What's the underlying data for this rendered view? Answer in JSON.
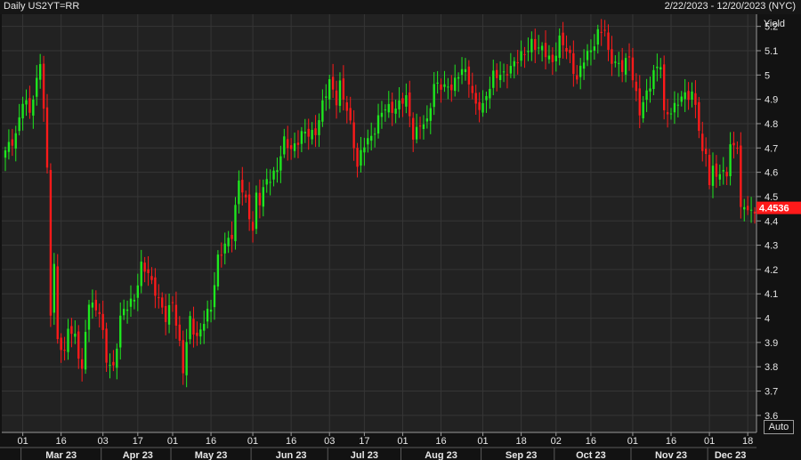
{
  "header": {
    "title": "Daily US2YT=RR",
    "date_range": "2/22/2023 - 12/20/2023 (NYC)"
  },
  "colors": {
    "up": "#1ee81e",
    "down": "#ff1a1a",
    "background": "#121212",
    "plot_background": "#222222",
    "grid": "#363636",
    "text": "#e6e6e6"
  },
  "auto_button": {
    "label": "Auto"
  },
  "chart_data": {
    "type": "candlestick",
    "ylabel": "Yield",
    "ylim": [
      3.53,
      5.25
    ],
    "y_ticks": [
      "3.6",
      "3.7",
      "3.8",
      "3.9",
      "4",
      "4.1",
      "4.2",
      "4.3",
      "4.4",
      "4.5",
      "4.6",
      "4.7",
      "4.8",
      "4.9",
      "5",
      "5.1",
      "5.2"
    ],
    "last_value": "4.4536",
    "x_day_ticks": [
      {
        "date": "2023-03-01",
        "label": "01"
      },
      {
        "date": "2023-03-16",
        "label": "16"
      },
      {
        "date": "2023-04-03",
        "label": "03"
      },
      {
        "date": "2023-04-17",
        "label": "17"
      },
      {
        "date": "2023-05-01",
        "label": "01"
      },
      {
        "date": "2023-05-16",
        "label": "16"
      },
      {
        "date": "2023-06-01",
        "label": "01"
      },
      {
        "date": "2023-06-16",
        "label": "16"
      },
      {
        "date": "2023-07-03",
        "label": "03"
      },
      {
        "date": "2023-07-17",
        "label": "17"
      },
      {
        "date": "2023-08-01",
        "label": "01"
      },
      {
        "date": "2023-08-16",
        "label": "16"
      },
      {
        "date": "2023-09-01",
        "label": "01"
      },
      {
        "date": "2023-09-18",
        "label": "18"
      },
      {
        "date": "2023-10-02",
        "label": "02"
      },
      {
        "date": "2023-10-16",
        "label": "16"
      },
      {
        "date": "2023-11-01",
        "label": "01"
      },
      {
        "date": "2023-11-16",
        "label": "16"
      },
      {
        "date": "2023-12-01",
        "label": "01"
      },
      {
        "date": "2023-12-18",
        "label": "18"
      }
    ],
    "x_month_labels": [
      {
        "date": "2023-03-16",
        "label": "Mar 23"
      },
      {
        "date": "2023-04-16",
        "label": "Apr 23"
      },
      {
        "date": "2023-05-16",
        "label": "May 23"
      },
      {
        "date": "2023-06-16",
        "label": "Jun 23"
      },
      {
        "date": "2023-07-16",
        "label": "Jul 23"
      },
      {
        "date": "2023-08-16",
        "label": "Aug 23"
      },
      {
        "date": "2023-09-16",
        "label": "Sep 23"
      },
      {
        "date": "2023-10-16",
        "label": "Oct 23"
      },
      {
        "date": "2023-11-16",
        "label": "Nov 23"
      },
      {
        "date": "2023-12-09",
        "label": "Dec 23"
      }
    ],
    "x_month_separators": [
      "2023-03-01",
      "2023-04-01",
      "2023-05-01",
      "2023-06-01",
      "2023-07-01",
      "2023-08-01",
      "2023-09-01",
      "2023-10-01",
      "2023-11-01",
      "2023-12-01"
    ],
    "x_range": [
      "2023-02-22",
      "2023-12-20"
    ],
    "close_anchors": [
      [
        "2023-02-22",
        4.68
      ],
      [
        "2023-02-27",
        4.76
      ],
      [
        "2023-03-01",
        4.89
      ],
      [
        "2023-03-03",
        4.85
      ],
      [
        "2023-03-07",
        4.98
      ],
      [
        "2023-03-08",
        5.06
      ],
      [
        "2023-03-09",
        4.85
      ],
      [
        "2023-03-10",
        4.6
      ],
      [
        "2023-03-13",
        4.03
      ],
      [
        "2023-03-14",
        4.22
      ],
      [
        "2023-03-15",
        3.92
      ],
      [
        "2023-03-17",
        3.84
      ],
      [
        "2023-03-20",
        3.96
      ],
      [
        "2023-03-22",
        3.93
      ],
      [
        "2023-03-24",
        3.78
      ],
      [
        "2023-03-28",
        4.07
      ],
      [
        "2023-03-31",
        4.03
      ],
      [
        "2023-04-04",
        3.82
      ],
      [
        "2023-04-06",
        3.8
      ],
      [
        "2023-04-10",
        4.0
      ],
      [
        "2023-04-14",
        4.09
      ],
      [
        "2023-04-18",
        4.21
      ],
      [
        "2023-04-20",
        4.18
      ],
      [
        "2023-04-24",
        4.12
      ],
      [
        "2023-04-27",
        3.99
      ],
      [
        "2023-05-01",
        4.08
      ],
      [
        "2023-05-03",
        3.89
      ],
      [
        "2023-05-04",
        3.78
      ],
      [
        "2023-05-08",
        4.0
      ],
      [
        "2023-05-10",
        3.92
      ],
      [
        "2023-05-12",
        3.98
      ],
      [
        "2023-05-16",
        4.05
      ],
      [
        "2023-05-18",
        4.25
      ],
      [
        "2023-05-22",
        4.29
      ],
      [
        "2023-05-24",
        4.35
      ],
      [
        "2023-05-26",
        4.57
      ],
      [
        "2023-05-30",
        4.47
      ],
      [
        "2023-06-01",
        4.37
      ],
      [
        "2023-06-02",
        4.51
      ],
      [
        "2023-06-05",
        4.48
      ],
      [
        "2023-06-07",
        4.56
      ],
      [
        "2023-06-12",
        4.62
      ],
      [
        "2023-06-14",
        4.72
      ],
      [
        "2023-06-16",
        4.7
      ],
      [
        "2023-06-21",
        4.75
      ],
      [
        "2023-06-27",
        4.77
      ],
      [
        "2023-06-29",
        4.87
      ],
      [
        "2023-06-30",
        4.92
      ],
      [
        "2023-07-03",
        4.98
      ],
      [
        "2023-07-05",
        4.9
      ],
      [
        "2023-07-06",
        4.96
      ],
      [
        "2023-07-07",
        4.89
      ],
      [
        "2023-07-10",
        4.86
      ],
      [
        "2023-07-11",
        4.8
      ],
      [
        "2023-07-12",
        4.72
      ],
      [
        "2023-07-13",
        4.63
      ],
      [
        "2023-07-17",
        4.71
      ],
      [
        "2023-07-19",
        4.75
      ],
      [
        "2023-07-21",
        4.82
      ],
      [
        "2023-07-25",
        4.86
      ],
      [
        "2023-07-28",
        4.87
      ],
      [
        "2023-08-02",
        4.9
      ],
      [
        "2023-08-04",
        4.76
      ],
      [
        "2023-08-08",
        4.79
      ],
      [
        "2023-08-10",
        4.8
      ],
      [
        "2023-08-14",
        4.97
      ],
      [
        "2023-08-17",
        4.94
      ],
      [
        "2023-08-21",
        4.96
      ],
      [
        "2023-08-24",
        5.02
      ],
      [
        "2023-08-28",
        4.98
      ],
      [
        "2023-08-30",
        4.88
      ],
      [
        "2023-09-01",
        4.86
      ],
      [
        "2023-09-06",
        5.01
      ],
      [
        "2023-09-11",
        4.99
      ],
      [
        "2023-09-14",
        5.06
      ],
      [
        "2023-09-19",
        5.08
      ],
      [
        "2023-09-21",
        5.14
      ],
      [
        "2023-09-25",
        5.11
      ],
      [
        "2023-09-29",
        5.06
      ],
      [
        "2023-10-03",
        5.14
      ],
      [
        "2023-10-06",
        5.08
      ],
      [
        "2023-10-10",
        4.98
      ],
      [
        "2023-10-12",
        5.06
      ],
      [
        "2023-10-16",
        5.11
      ],
      [
        "2023-10-18",
        5.17
      ],
      [
        "2023-10-20",
        5.18
      ],
      [
        "2023-10-23",
        5.09
      ],
      [
        "2023-10-27",
        5.02
      ],
      [
        "2023-10-31",
        5.08
      ],
      [
        "2023-11-01",
        5.0
      ],
      [
        "2023-11-03",
        4.84
      ],
      [
        "2023-11-07",
        4.92
      ],
      [
        "2023-11-09",
        5.02
      ],
      [
        "2023-11-13",
        5.04
      ],
      [
        "2023-11-14",
        4.83
      ],
      [
        "2023-11-16",
        4.86
      ],
      [
        "2023-11-20",
        4.89
      ],
      [
        "2023-11-24",
        4.93
      ],
      [
        "2023-11-27",
        4.88
      ],
      [
        "2023-11-28",
        4.78
      ],
      [
        "2023-11-29",
        4.66
      ],
      [
        "2023-11-30",
        4.68
      ],
      [
        "2023-12-01",
        4.56
      ],
      [
        "2023-12-04",
        4.62
      ],
      [
        "2023-12-06",
        4.58
      ],
      [
        "2023-12-08",
        4.6
      ],
      [
        "2023-12-11",
        4.71
      ],
      [
        "2023-12-12",
        4.72
      ],
      [
        "2023-12-13",
        4.71
      ],
      [
        "2023-12-14",
        4.43
      ],
      [
        "2023-12-15",
        4.46
      ],
      [
        "2023-12-18",
        4.45
      ],
      [
        "2023-12-19",
        4.44
      ],
      [
        "2023-12-20",
        4.4536
      ]
    ]
  }
}
